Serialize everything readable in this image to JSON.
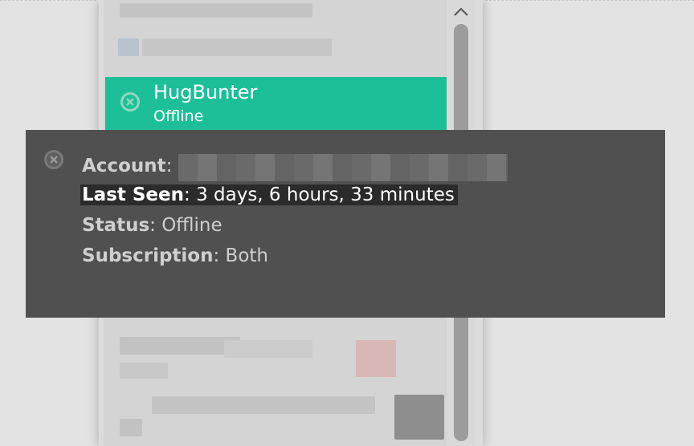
{
  "contact": {
    "name": "HugBunter",
    "status": "Offline"
  },
  "tooltip": {
    "account_label": "Account",
    "last_seen_label": "Last Seen",
    "last_seen_value": "3 days, 6 hours, 33 minutes",
    "status_label": "Status",
    "status_value": "Offline",
    "subscription_label": "Subscription",
    "subscription_value": "Both"
  },
  "icons": {
    "contact_status": "offline-x-icon",
    "tooltip_status": "offline-x-icon",
    "scroll_up": "chevron-up-icon"
  },
  "colors": {
    "selected_row": "#1dbf99",
    "tooltip_bg": "#505050",
    "highlight_bg": "#2b2b2b"
  }
}
